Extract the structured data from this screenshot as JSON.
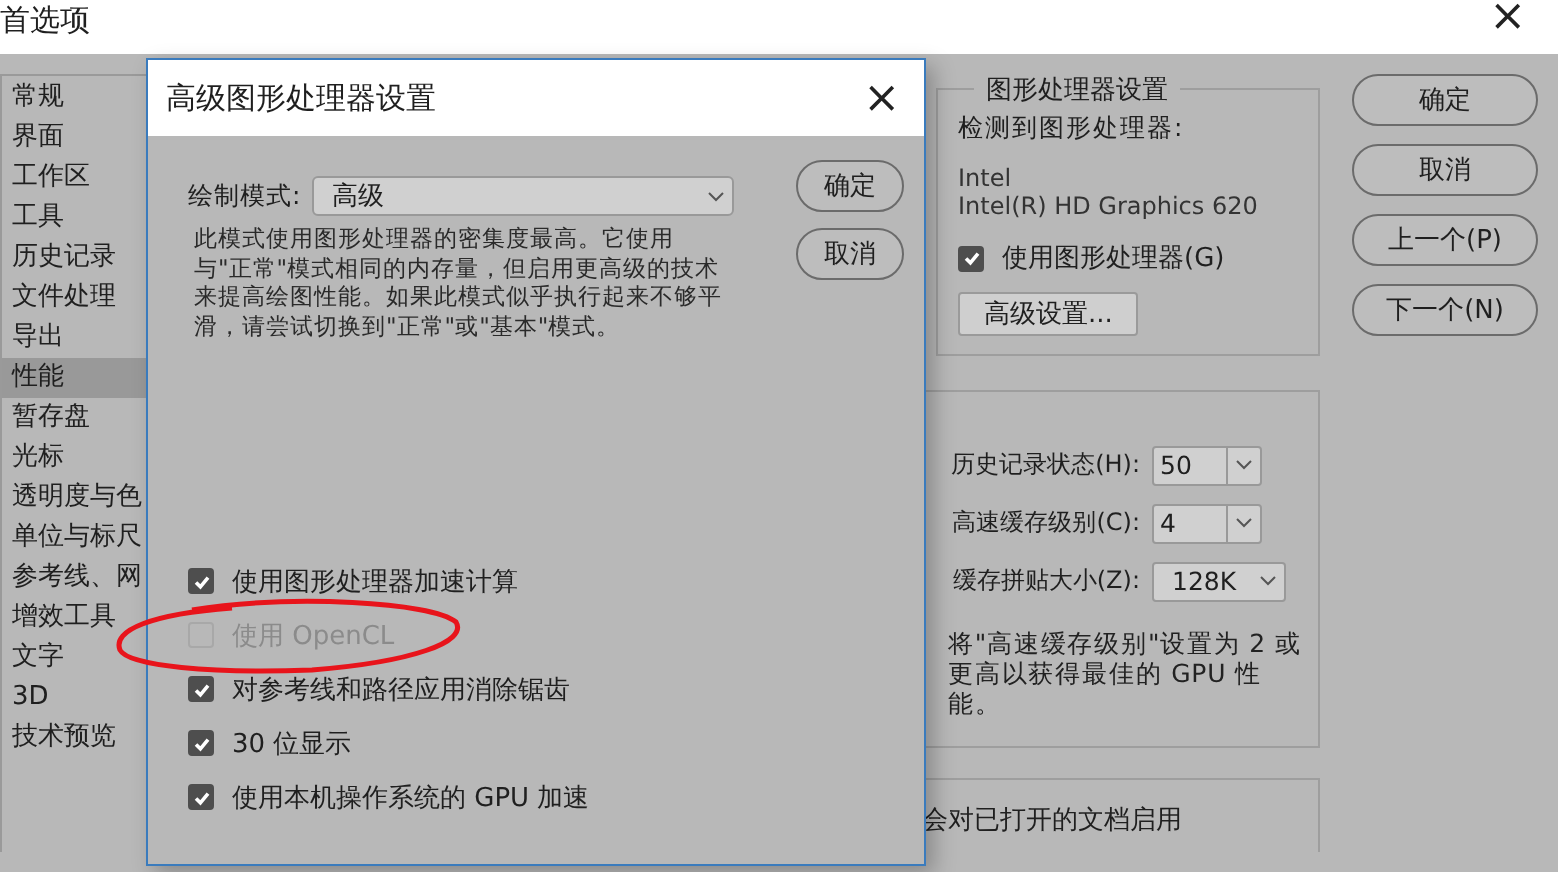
{
  "window": {
    "title": "首选项",
    "close": "×"
  },
  "sidebar": {
    "items": [
      {
        "label": "常规",
        "selected": false
      },
      {
        "label": "界面",
        "selected": false
      },
      {
        "label": "工作区",
        "selected": false
      },
      {
        "label": "工具",
        "selected": false
      },
      {
        "label": "历史记录",
        "selected": false
      },
      {
        "label": "文件处理",
        "selected": false
      },
      {
        "label": "导出",
        "selected": false
      },
      {
        "label": "性能",
        "selected": true
      },
      {
        "label": "暂存盘",
        "selected": false
      },
      {
        "label": "光标",
        "selected": false
      },
      {
        "label": "透明度与色",
        "selected": false
      },
      {
        "label": "单位与标尺",
        "selected": false
      },
      {
        "label": "参考线、网",
        "selected": false
      },
      {
        "label": "增效工具",
        "selected": false
      },
      {
        "label": "文字",
        "selected": false
      },
      {
        "label": "3D",
        "selected": false
      },
      {
        "label": "技术预览",
        "selected": false
      }
    ]
  },
  "gpu_group": {
    "title": "图形处理器设置",
    "detected_label": "检测到图形处理器:",
    "vendor": "Intel",
    "model": "Intel(R) HD Graphics 620",
    "use_gpu": {
      "label": "使用图形处理器(G)",
      "checked": true
    },
    "advanced_button": "高级设置..."
  },
  "history_group": {
    "fields": [
      {
        "label": "历史记录状态(H):",
        "value": "50",
        "kind": "split"
      },
      {
        "label": "高速缓存级别(C):",
        "value": "4",
        "kind": "split"
      },
      {
        "label": "缓存拼贴大小(Z):",
        "value": "128K",
        "kind": "plain"
      }
    ],
    "note": "将\"高速缓存级别\"设置为 2 或更高以获得最佳的 GPU 性能。"
  },
  "bottom_group": {
    "text": "会对已打开的文档启用"
  },
  "buttons": [
    "确定",
    "取消",
    "上一个(P)",
    "下一个(N)"
  ],
  "dialog": {
    "title": "高级图形处理器设置",
    "close": "×",
    "mode_label": "绘制模式:",
    "mode_value": "高级",
    "description": "此模式使用图形处理器的密集度最高。它使用与\"正常\"模式相同的内存量，但启用更高级的技术来提高绘图性能。如果此模式似乎执行起来不够平滑，请尝试切换到\"正常\"或\"基本\"模式。",
    "buttons": [
      "确定",
      "取消"
    ],
    "options": [
      {
        "label": "使用图形处理器加速计算",
        "checked": true,
        "disabled": false
      },
      {
        "label": "使用 OpenCL",
        "checked": false,
        "disabled": true
      },
      {
        "label": "对参考线和路径应用消除锯齿",
        "checked": true,
        "disabled": false
      },
      {
        "label": "30 位显示",
        "checked": true,
        "disabled": false
      },
      {
        "label": "使用本机操作系统的 GPU 加速",
        "checked": true,
        "disabled": false
      }
    ]
  }
}
